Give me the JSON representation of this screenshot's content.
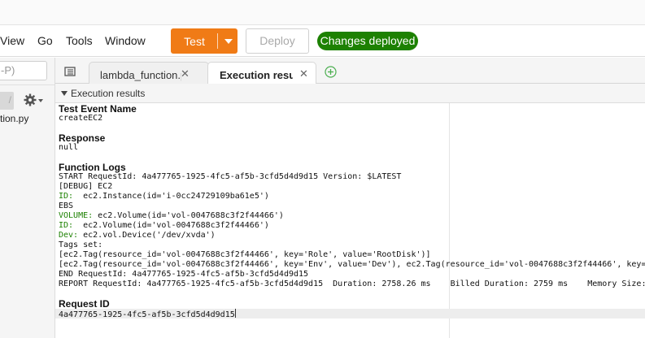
{
  "menu": [
    "View",
    "Go",
    "Tools",
    "Window"
  ],
  "toolbar": {
    "test_label": "Test",
    "deploy_label": "Deploy",
    "status_badge": "Changes deployed"
  },
  "sidebar": {
    "search_placeholder": "-P)",
    "file_name": "tion.py"
  },
  "tabs": [
    {
      "label": "lambda_function.py",
      "close": "✕"
    },
    {
      "label": "Execution results",
      "close": "✕"
    }
  ],
  "results": {
    "header": "Execution results",
    "test_event_label": "Test Event Name",
    "test_event_value": "createEC2",
    "response_label": "Response",
    "response_value": "null",
    "logs_label": "Function Logs",
    "log_lines": [
      {
        "k": "",
        "t": "START RequestId: 4a477765-1925-4fc5-af5b-3cfd5d4d9d15 Version: $LATEST"
      },
      {
        "k": "",
        "t": "[DEBUG] EC2"
      },
      {
        "k": "ID:",
        "t": "  ec2.Instance(id='i-0cc24729109ba61e5')"
      },
      {
        "k": "",
        "t": "EBS"
      },
      {
        "k": "VOLUME:",
        "t": " ec2.Volume(id='vol-0047688c3f2f44466')"
      },
      {
        "k": "ID:",
        "t": "  ec2.Volume(id='vol-0047688c3f2f44466')"
      },
      {
        "k": "Dev:",
        "t": " ec2.vol.Device('/dev/xvda')"
      },
      {
        "k": "",
        "t": "Tags set:"
      },
      {
        "k": "",
        "t": "[ec2.Tag(resource_id='vol-0047688c3f2f44466', key='Role', value='RootDisk')]"
      },
      {
        "k": "",
        "t": "[ec2.Tag(resource_id='vol-0047688c3f2f44466', key='Env', value='Dev'), ec2.Tag(resource_id='vol-0047688c3f2f44466', key="
      },
      {
        "k": "",
        "t": "END RequestId: 4a477765-1925-4fc5-af5b-3cfd5d4d9d15"
      },
      {
        "k": "",
        "t": "REPORT RequestId: 4a477765-1925-4fc5-af5b-3cfd5d4d9d15  Duration: 2758.26 ms    Billed Duration: 2759 ms    Memory Size: "
      }
    ],
    "request_id_label": "Request ID",
    "request_id_value": "4a477765-1925-4fc5-af5b-3cfd5d4d9d15"
  },
  "colors": {
    "test_button": "#f07b16",
    "status_badge": "#1d8102",
    "log_keyword": "#1d8102"
  }
}
